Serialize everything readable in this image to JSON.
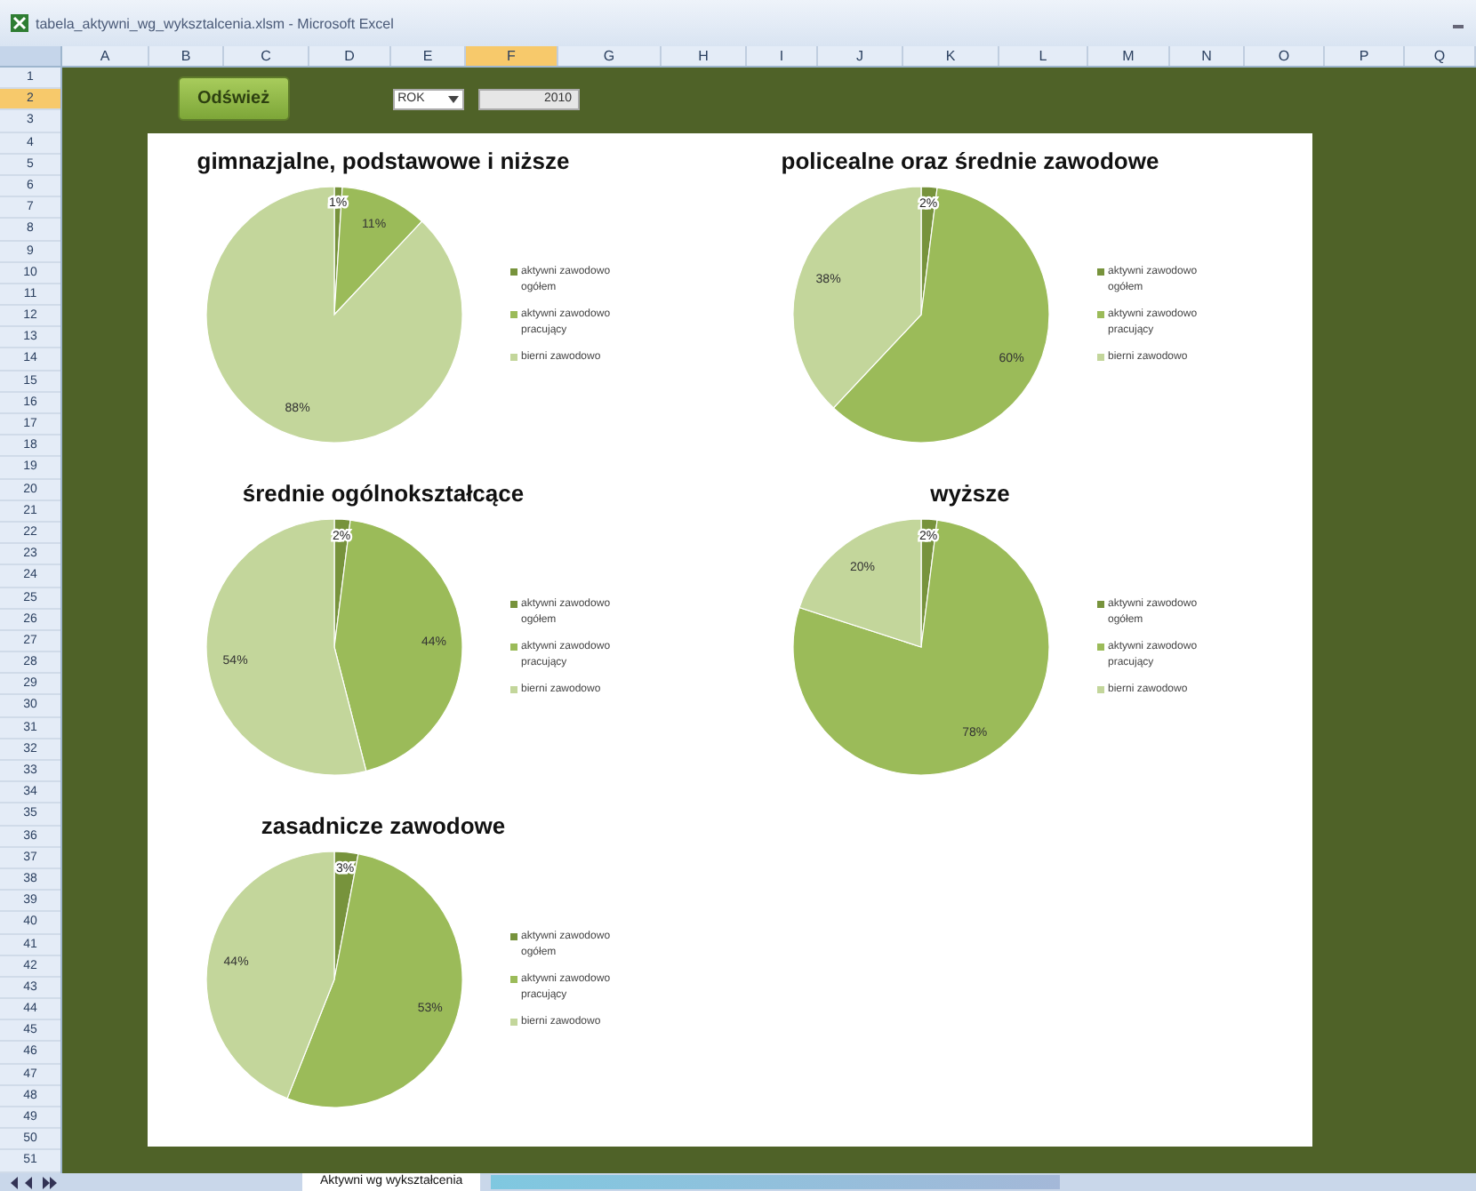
{
  "window": {
    "title": "tabela_aktywni_wg_wyksztalcenia.xlsm - Microsoft Excel"
  },
  "columns": [
    {
      "label": "A",
      "selected": false
    },
    {
      "label": "B",
      "selected": false
    },
    {
      "label": "C",
      "selected": false
    },
    {
      "label": "D",
      "selected": false
    },
    {
      "label": "E",
      "selected": false
    },
    {
      "label": "F",
      "selected": true
    },
    {
      "label": "G",
      "selected": false
    },
    {
      "label": "H",
      "selected": false
    },
    {
      "label": "I",
      "selected": false
    },
    {
      "label": "J",
      "selected": false
    },
    {
      "label": "K",
      "selected": false
    },
    {
      "label": "L",
      "selected": false
    },
    {
      "label": "M",
      "selected": false
    },
    {
      "label": "N",
      "selected": false
    },
    {
      "label": "O",
      "selected": false
    },
    {
      "label": "P",
      "selected": false
    },
    {
      "label": "Q",
      "selected": false
    }
  ],
  "rows": [
    {
      "label": "1",
      "selected": false
    },
    {
      "label": "2",
      "selected": true
    },
    {
      "label": "3",
      "selected": false
    },
    {
      "label": "4",
      "selected": false
    },
    {
      "label": "5",
      "selected": false
    },
    {
      "label": "6",
      "selected": false
    },
    {
      "label": "7",
      "selected": false
    },
    {
      "label": "8",
      "selected": false
    },
    {
      "label": "9",
      "selected": false
    },
    {
      "label": "10",
      "selected": false
    },
    {
      "label": "11",
      "selected": false
    },
    {
      "label": "12",
      "selected": false
    },
    {
      "label": "13",
      "selected": false
    },
    {
      "label": "14",
      "selected": false
    },
    {
      "label": "15",
      "selected": false
    },
    {
      "label": "16",
      "selected": false
    },
    {
      "label": "17",
      "selected": false
    },
    {
      "label": "18",
      "selected": false
    },
    {
      "label": "19",
      "selected": false
    },
    {
      "label": "20",
      "selected": false
    },
    {
      "label": "21",
      "selected": false
    },
    {
      "label": "22",
      "selected": false
    },
    {
      "label": "23",
      "selected": false
    },
    {
      "label": "24",
      "selected": false
    },
    {
      "label": "25",
      "selected": false
    },
    {
      "label": "26",
      "selected": false
    },
    {
      "label": "27",
      "selected": false
    },
    {
      "label": "28",
      "selected": false
    },
    {
      "label": "29",
      "selected": false
    },
    {
      "label": "30",
      "selected": false
    },
    {
      "label": "31",
      "selected": false
    },
    {
      "label": "32",
      "selected": false
    },
    {
      "label": "33",
      "selected": false
    },
    {
      "label": "34",
      "selected": false
    },
    {
      "label": "35",
      "selected": false
    },
    {
      "label": "36",
      "selected": false
    },
    {
      "label": "37",
      "selected": false
    },
    {
      "label": "38",
      "selected": false
    },
    {
      "label": "39",
      "selected": false
    },
    {
      "label": "40",
      "selected": false
    },
    {
      "label": "41",
      "selected": false
    },
    {
      "label": "42",
      "selected": false
    },
    {
      "label": "43",
      "selected": false
    },
    {
      "label": "44",
      "selected": false
    },
    {
      "label": "45",
      "selected": false
    },
    {
      "label": "46",
      "selected": false
    },
    {
      "label": "47",
      "selected": false
    },
    {
      "label": "48",
      "selected": false
    },
    {
      "label": "49",
      "selected": false
    },
    {
      "label": "50",
      "selected": false
    },
    {
      "label": "51",
      "selected": false
    }
  ],
  "refresh_button": {
    "label": "Odśwież"
  },
  "filter": {
    "label": "ROK",
    "value": "2010"
  },
  "charts": [
    {
      "title": "gimnazjalne, podstawowe i niższe",
      "legend": [
        {
          "color": "#77933c"
        },
        {
          "color": "#9bbb59"
        },
        {
          "color": "#c3d69b"
        }
      ],
      "chart_data": {
        "type": "pie",
        "categories": [
          "aktywni zawodowo ogółem",
          "aktywni zawodowo pracujący",
          "bierni zawodowo"
        ],
        "values": [
          1,
          11,
          88
        ],
        "data_labels": true,
        "value_labels": [
          "1%",
          "11%",
          "88%"
        ]
      }
    },
    {
      "title": "policealne oraz średnie zawodowe",
      "legend": [
        {
          "color": "#77933c"
        },
        {
          "color": "#9bbb59"
        },
        {
          "color": "#c3d69b"
        }
      ],
      "chart_data": {
        "type": "pie",
        "categories": [
          "aktywni zawodowo ogółem",
          "aktywni zawodowo pracujący",
          "bierni zawodowo"
        ],
        "values": [
          2,
          60,
          38
        ],
        "data_labels": true,
        "value_labels": [
          "2%",
          "60%",
          "38%"
        ]
      }
    },
    {
      "title": "średnie ogólnokształcące",
      "legend": [
        {
          "color": "#77933c"
        },
        {
          "color": "#9bbb59"
        },
        {
          "color": "#c3d69b"
        }
      ],
      "chart_data": {
        "type": "pie",
        "categories": [
          "aktywni zawodowo ogółem",
          "aktywni zawodowo pracujący",
          "bierni zawodowo"
        ],
        "values": [
          2,
          44,
          54
        ],
        "data_labels": true,
        "value_labels": [
          "2%",
          "44%",
          "54%"
        ]
      }
    },
    {
      "title": "wyższe",
      "legend": [
        {
          "color": "#77933c"
        },
        {
          "color": "#9bbb59"
        },
        {
          "color": "#c3d69b"
        }
      ],
      "chart_data": {
        "type": "pie",
        "categories": [
          "aktywni zawodowo ogółem",
          "aktywni zawodowo pracujący",
          "bierni zawodowo"
        ],
        "values": [
          2,
          78,
          20
        ],
        "data_labels": true,
        "value_labels": [
          "2%",
          "78%",
          "20%"
        ]
      }
    },
    {
      "title": "zasadnicze zawodowe",
      "legend": [
        {
          "color": "#77933c"
        },
        {
          "color": "#9bbb59"
        },
        {
          "color": "#c3d69b"
        }
      ],
      "chart_data": {
        "type": "pie",
        "categories": [
          "aktywni zawodowo ogółem",
          "aktywni zawodowo pracujący",
          "bierni zawodowo"
        ],
        "values": [
          3,
          53,
          44
        ],
        "data_labels": true,
        "value_labels": [
          "3%",
          "53%",
          "44%"
        ]
      }
    }
  ],
  "sheet_tabs": [
    {
      "label": "Aktywni wg wykształcenia",
      "selected": true
    }
  ]
}
